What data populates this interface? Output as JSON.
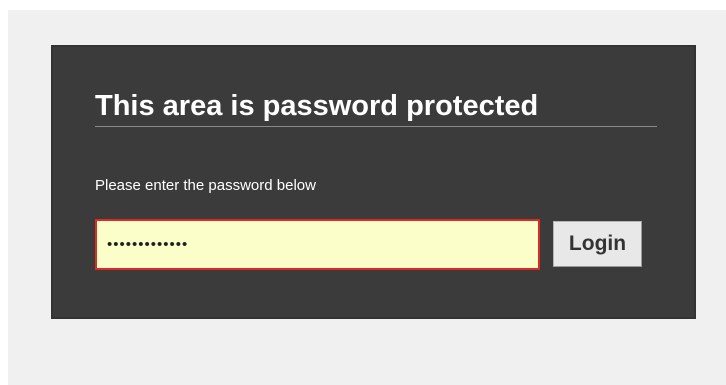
{
  "login": {
    "title": "This area is password protected",
    "instructions": "Please enter the password below",
    "password_value": "•••••••••••••",
    "submit_label": "Login"
  },
  "colors": {
    "panel_background": "#3b3b3b",
    "page_background": "#f0f0f0",
    "input_background": "#fbfec8",
    "input_error_border": "#dd2a22"
  }
}
